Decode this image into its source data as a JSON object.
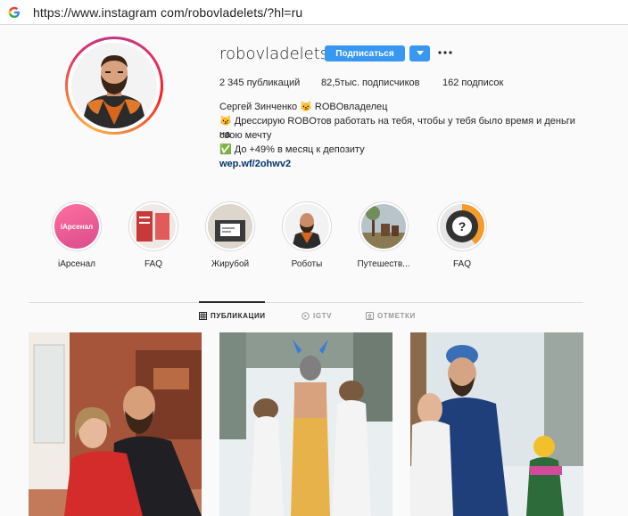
{
  "browser": {
    "url": "https://www.instagram com/robovladelets/?hl=ru",
    "favicon_icon": "google-g-icon"
  },
  "profile": {
    "username": "robovladelets",
    "follow_label": "Подписаться",
    "stats": {
      "posts": "2 345 публикаций",
      "followers": "82,5тыс. подписчиков",
      "following": "162 подписок"
    },
    "bio": {
      "name": "Сергей Зинченко 😼 ROBOвладелец",
      "line1": "😼 Дрессирую ROBOтов работать на тебя, чтобы у тебя было время и деньги на",
      "line2": "свою мечту",
      "line3": "✅ До +49% в месяц к депозиту",
      "link": "wep.wf/2ohwv2"
    }
  },
  "highlights": [
    {
      "label": "iАрсенал",
      "thumb_text": "iАрсенал"
    },
    {
      "label": "FAQ"
    },
    {
      "label": "Жирубой"
    },
    {
      "label": "Роботы"
    },
    {
      "label": "Путешеств..."
    },
    {
      "label": "FAQ",
      "thumb_text": "?"
    }
  ],
  "tabs": [
    {
      "label": "ПУБЛИКАЦИИ",
      "icon": "grid-icon",
      "active": true
    },
    {
      "label": "IGTV",
      "icon": "igtv-icon",
      "active": false
    },
    {
      "label": "ОТМЕТКИ",
      "icon": "tag-icon",
      "active": false
    }
  ],
  "colors": {
    "accent": "#3897f0",
    "link": "#003569"
  }
}
